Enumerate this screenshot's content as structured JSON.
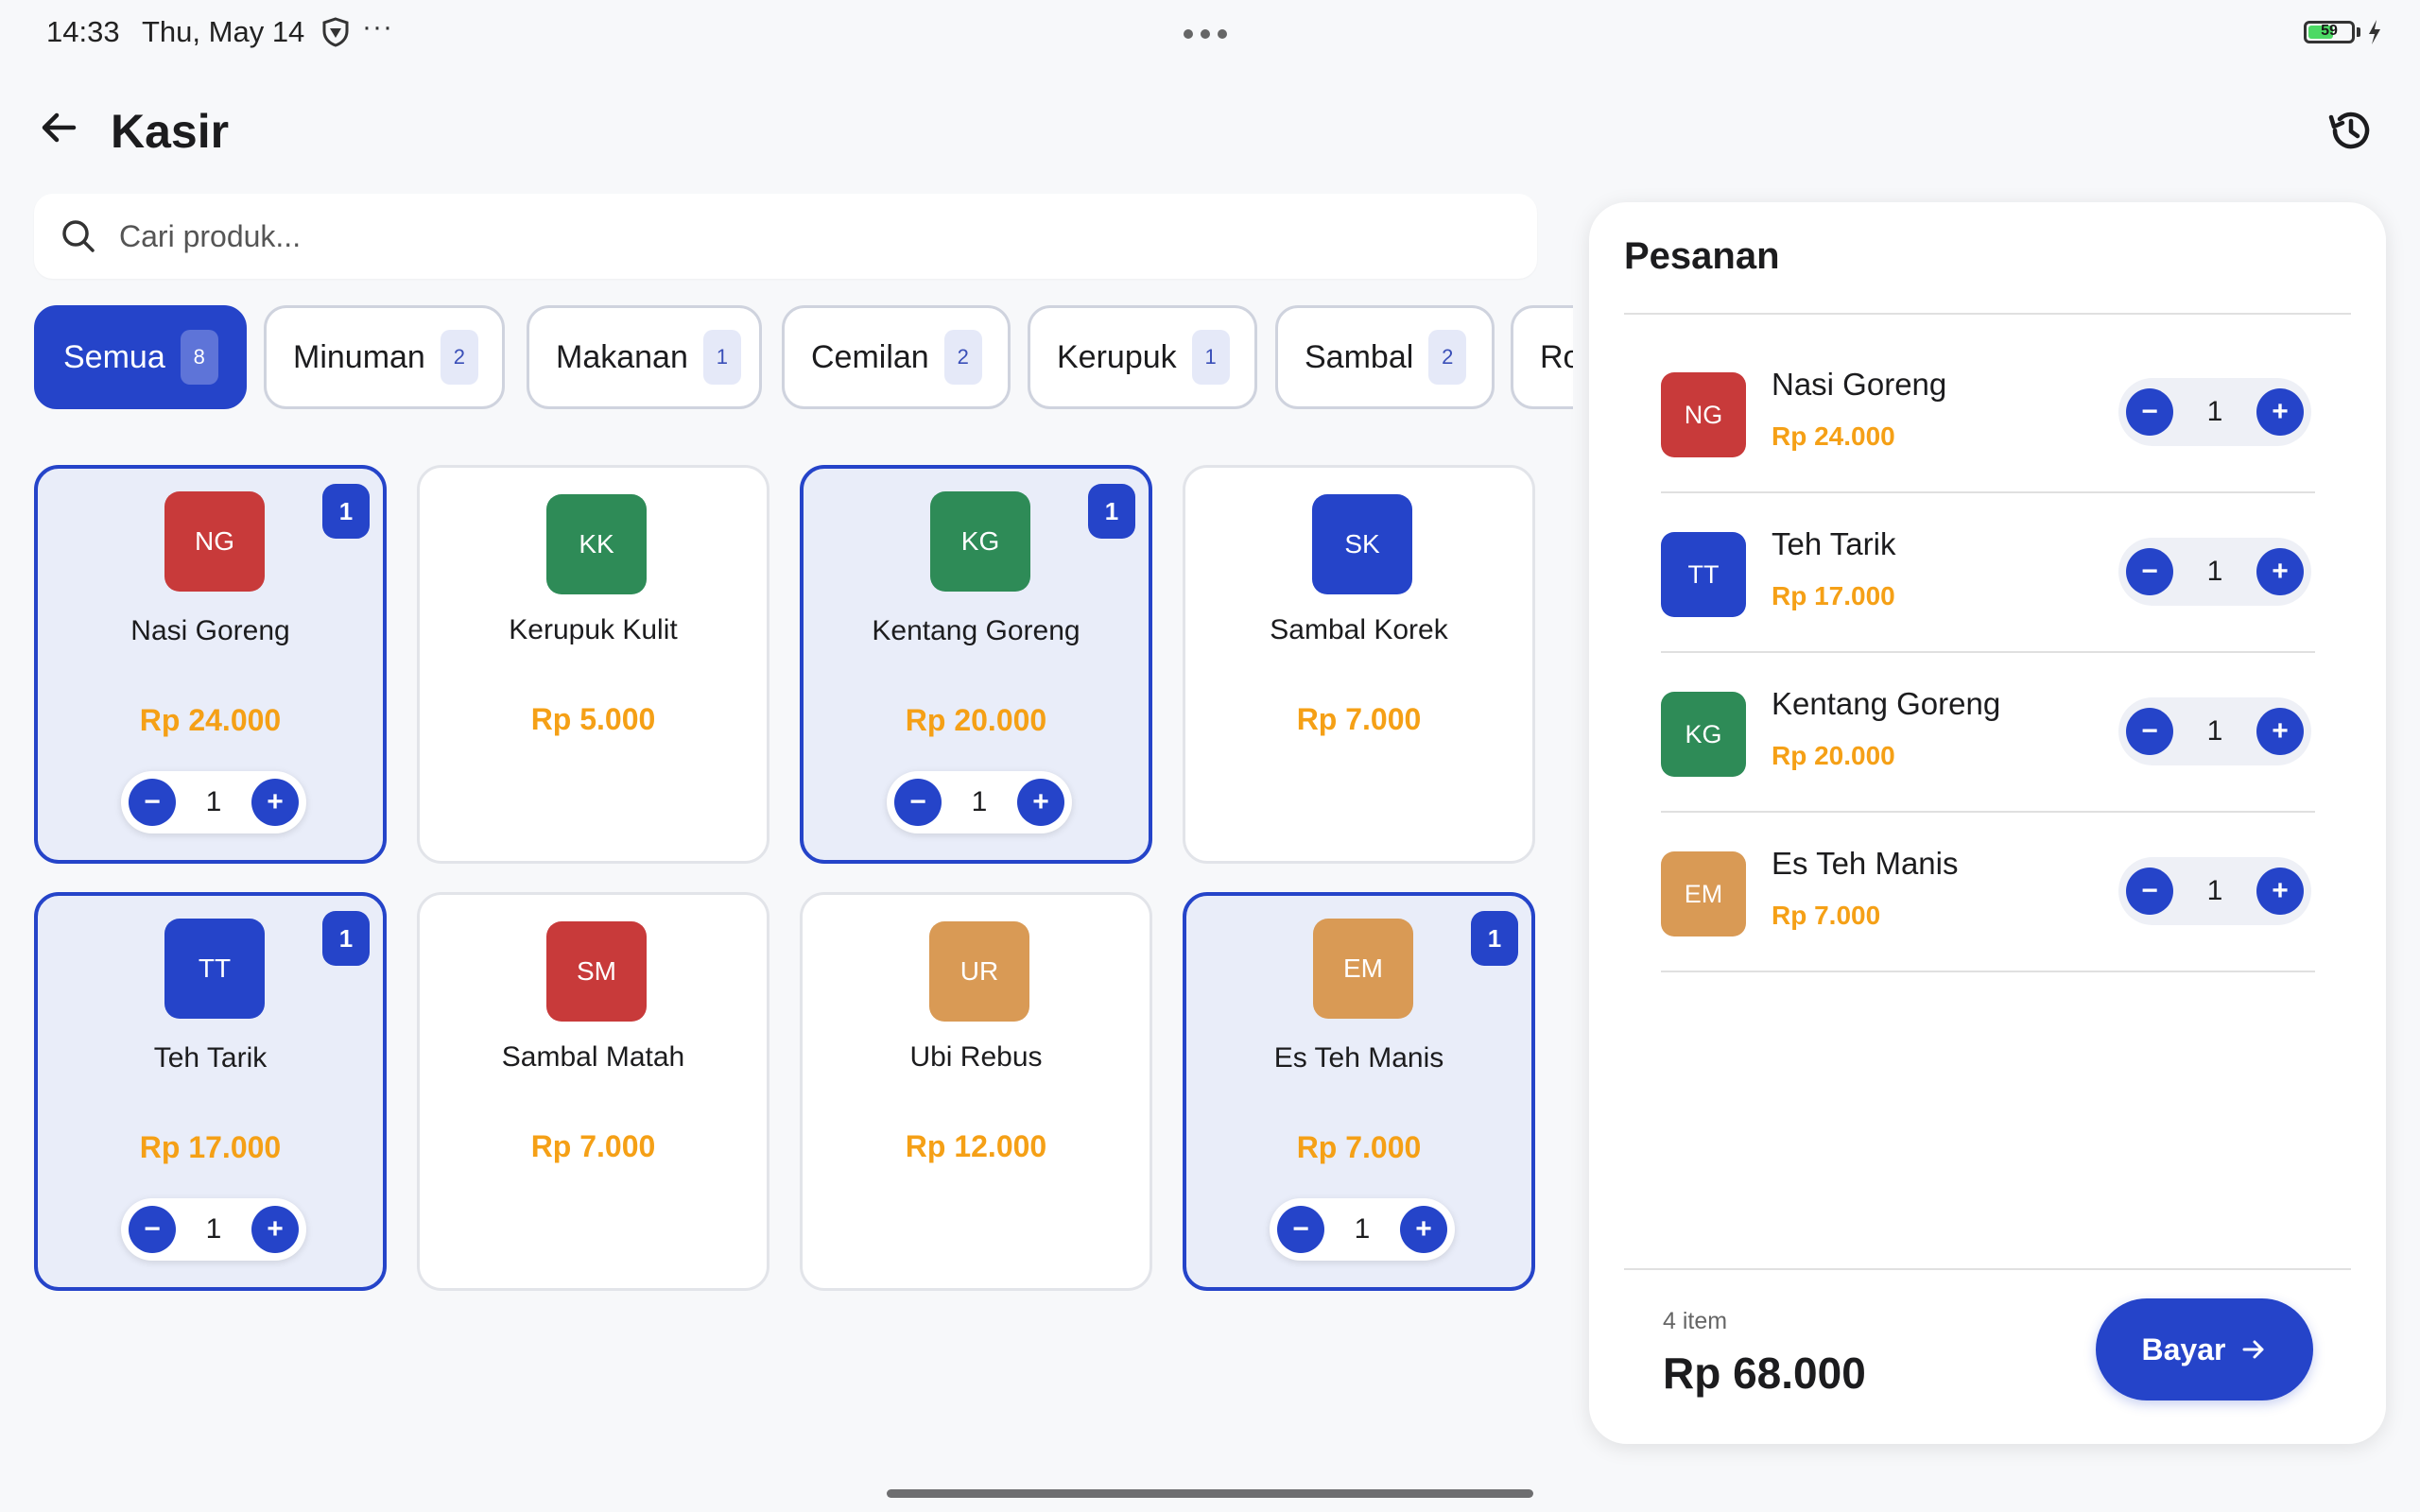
{
  "status_bar": {
    "time": "14:33",
    "date": "Thu, May 14",
    "more": "···",
    "battery": "59",
    "battery_level": 0.59
  },
  "header": {
    "title": "Kasir",
    "back_icon": "arrow-left-icon",
    "history_icon": "history-icon"
  },
  "search": {
    "placeholder": "Cari produk...",
    "value": ""
  },
  "categories": [
    {
      "label": "Semua",
      "count": "8",
      "active": true
    },
    {
      "label": "Minuman",
      "count": "2"
    },
    {
      "label": "Makanan",
      "count": "1"
    },
    {
      "label": "Cemilan",
      "count": "2"
    },
    {
      "label": "Kerupuk",
      "count": "1"
    },
    {
      "label": "Sambal",
      "count": "2"
    },
    {
      "label": "Ro",
      "count": ""
    }
  ],
  "products": [
    {
      "initials": "NG",
      "name": "Nasi Goreng",
      "price": "Rp 24.000",
      "color": "#c83a3a",
      "qty": "1",
      "badge": "1"
    },
    {
      "initials": "KK",
      "name": "Kerupuk Kulit",
      "price": "Rp 5.000",
      "color": "#2e8b57"
    },
    {
      "initials": "KG",
      "name": "Kentang Goreng",
      "price": "Rp 20.000",
      "color": "#2e8b57",
      "qty": "1",
      "badge": "1"
    },
    {
      "initials": "SK",
      "name": "Sambal Korek",
      "price": "Rp 7.000",
      "color": "#2544c9"
    },
    {
      "initials": "TT",
      "name": "Teh Tarik",
      "price": "Rp 17.000",
      "color": "#2544c9",
      "qty": "1",
      "badge": "1"
    },
    {
      "initials": "SM",
      "name": "Sambal Matah",
      "price": "Rp 7.000",
      "color": "#c83a3a"
    },
    {
      "initials": "UR",
      "name": "Ubi Rebus",
      "price": "Rp 12.000",
      "color": "#d99a55"
    },
    {
      "initials": "EM",
      "name": "Es Teh Manis",
      "price": "Rp 7.000",
      "color": "#d99a55",
      "qty": "1",
      "badge": "1"
    }
  ],
  "stepper": {
    "minus": "−",
    "plus": "+"
  },
  "order": {
    "title": "Pesanan",
    "items": [
      {
        "initials": "NG",
        "name": "Nasi Goreng",
        "price": "Rp 24.000",
        "qty": "1",
        "color": "#c83a3a"
      },
      {
        "initials": "TT",
        "name": "Teh Tarik",
        "price": "Rp 17.000",
        "qty": "1",
        "color": "#2544c9"
      },
      {
        "initials": "KG",
        "name": "Kentang Goreng",
        "price": "Rp 20.000",
        "qty": "1",
        "color": "#2e8b57"
      },
      {
        "initials": "EM",
        "name": "Es Teh Manis",
        "price": "Rp 7.000",
        "qty": "1",
        "color": "#d99a55"
      }
    ],
    "item_count": "4 item",
    "total": "Rp 68.000",
    "pay_label": "Bayar"
  },
  "colors": {
    "accent": "#2544c9",
    "price": "#f5a016",
    "selected_bg": "#e9edf9"
  }
}
